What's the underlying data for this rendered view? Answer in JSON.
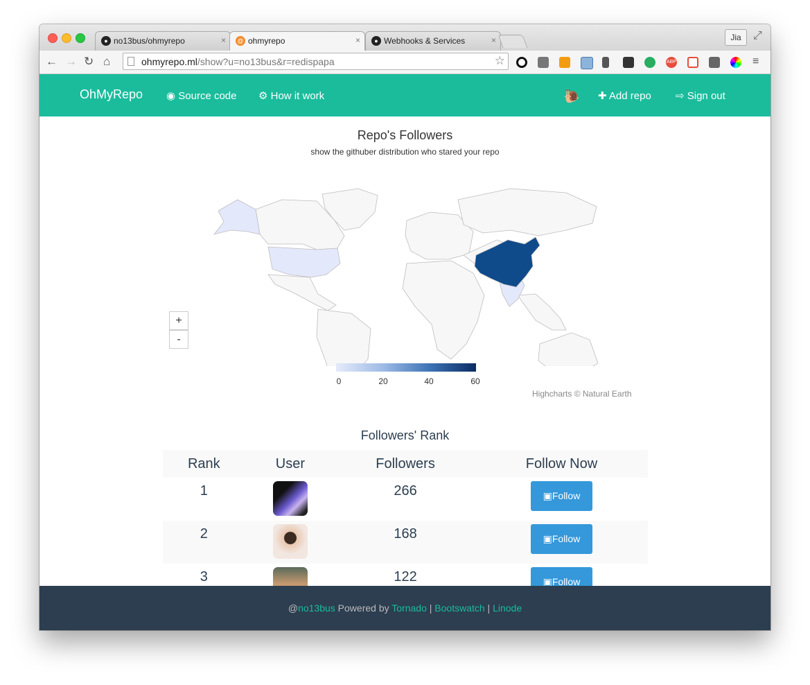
{
  "browser": {
    "tabs": [
      {
        "title": "no13bus/ohmyrepo",
        "active": false
      },
      {
        "title": "ohmyrepo",
        "active": true
      },
      {
        "title": "Webhooks & Services",
        "active": false
      }
    ],
    "tab_close": "×",
    "user_button": "Jia",
    "url_host": "ohmyrepo.ml",
    "url_path": "/show?u=no13bus&r=redispapa",
    "extension_badge_abp": "ABP"
  },
  "navbar": {
    "brand": "OhMyRepo",
    "source_code": "Source code",
    "how_it_work": "How it work",
    "add_repo": "Add repo",
    "sign_out": "Sign out",
    "colors": {
      "bg": "#1abc9c"
    }
  },
  "map": {
    "title": "Repo's Followers",
    "subtitle": "show the githuber distribution who stared your repo",
    "zoom_in": "+",
    "zoom_out": "-",
    "credits": "Highcharts © Natural Earth",
    "colorbar_ticks": [
      "0",
      "20",
      "40",
      "60"
    ],
    "colorbar_min_color": "#e6ebfa",
    "colorbar_max_color": "#0a2c63",
    "land_color": "#f7f7f7",
    "highlighted": [
      {
        "country": "China",
        "level": "high",
        "color": "#0f4a8a"
      },
      {
        "country": "United States",
        "level": "low",
        "color": "#e4e8fb"
      },
      {
        "country": "India",
        "level": "low",
        "color": "#e4e8fb"
      }
    ]
  },
  "rank": {
    "title": "Followers' Rank",
    "headers": [
      "Rank",
      "User",
      "Followers",
      "Follow Now"
    ],
    "follow_label": "Follow",
    "rows": [
      {
        "rank": "1",
        "followers": "266"
      },
      {
        "rank": "2",
        "followers": "168"
      },
      {
        "rank": "3",
        "followers": "122"
      }
    ]
  },
  "footer": {
    "at": "@",
    "user": "no13bus",
    "powered": " Powered by ",
    "tornado": "Tornado",
    "sep": " | ",
    "bootswatch": "Bootswatch",
    "linode": "Linode"
  }
}
